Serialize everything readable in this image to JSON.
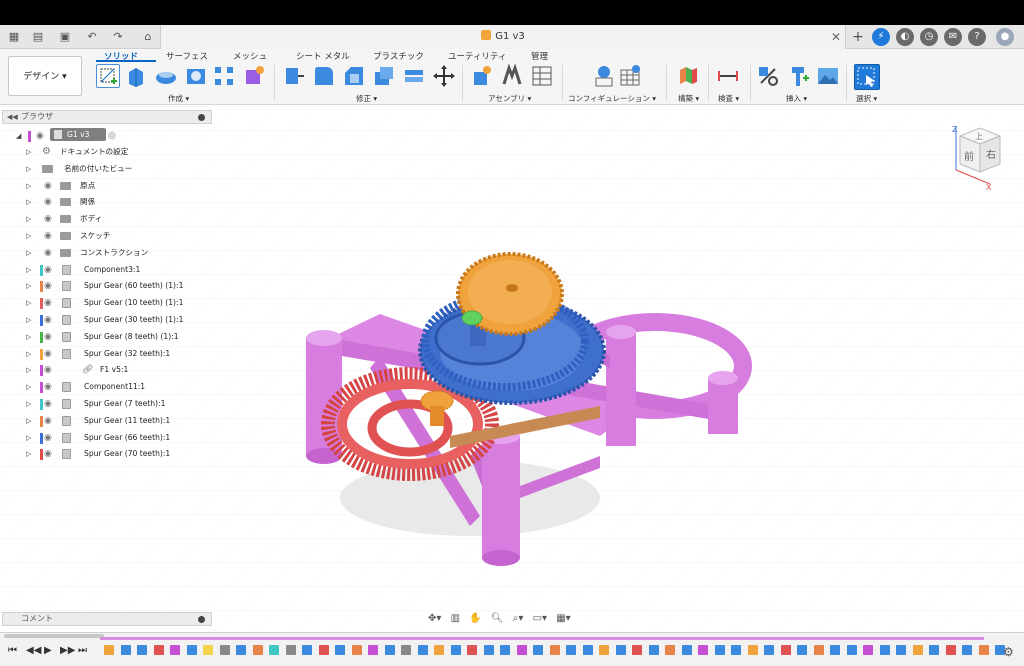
{
  "app": {
    "document_title": "G1 v3"
  },
  "ribbon": {
    "workspace_button": "デザイン ▾",
    "tabs": [
      "ソリッド",
      "サーフェス",
      "メッシュ",
      "シート メタル",
      "プラスチック",
      "ユーティリティ",
      "管理"
    ],
    "groups": [
      "作成 ▾",
      "修正 ▾",
      "アセンブリ ▾",
      "コンフィギュレーション ▾",
      "構築 ▾",
      "検査 ▾",
      "挿入 ▾",
      "選択 ▾"
    ]
  },
  "browser": {
    "title": "ブラウザ",
    "root_label": "G1 v3",
    "items": [
      {
        "label": "ドキュメントの設定"
      },
      {
        "label": "名前の付いたビュー"
      },
      {
        "label": "原点"
      },
      {
        "label": "関係"
      },
      {
        "label": "ボディ"
      },
      {
        "label": "スケッチ"
      },
      {
        "label": "コンストラクション"
      },
      {
        "label": "Component3:1",
        "color": "#3fc7c7"
      },
      {
        "label": "Spur Gear (60 teeth) (1):1",
        "color": "#e8834a"
      },
      {
        "label": "Spur Gear (10 teeth) (1):1",
        "color": "#e06060"
      },
      {
        "label": "Spur Gear (30 teeth) (1):1",
        "color": "#3d6fd8"
      },
      {
        "label": "Spur Gear (8 teeth) (1):1",
        "color": "#46b546"
      },
      {
        "label": "Spur Gear (32 teeth):1",
        "color": "#f2a33a"
      },
      {
        "label": "F1 v5:1",
        "color": "#c44fd3"
      },
      {
        "label": "Component11:1",
        "color": "#c44fd3"
      },
      {
        "label": "Spur Gear (7 teeth):1",
        "color": "#3fc7c7"
      },
      {
        "label": "Spur Gear (11 teeth):1",
        "color": "#e8834a"
      },
      {
        "label": "Spur Gear (66 teeth):1",
        "color": "#3d6fd8"
      },
      {
        "label": "Spur Gear (70 teeth):1",
        "color": "#e04a4a"
      }
    ]
  },
  "comments": {
    "title": "コメント"
  },
  "viewcube": {
    "top": "上",
    "front": "前",
    "right": "右",
    "axis_z": "Z",
    "axis_x": "X"
  },
  "colors": {
    "accent": "#0a66c2",
    "frame_pink": "#e08ce8",
    "gear_orange": "#f0a23c",
    "gear_blue": "#4a78d0",
    "gear_red": "#e05252",
    "timeline_bar": "#d88ee0"
  }
}
